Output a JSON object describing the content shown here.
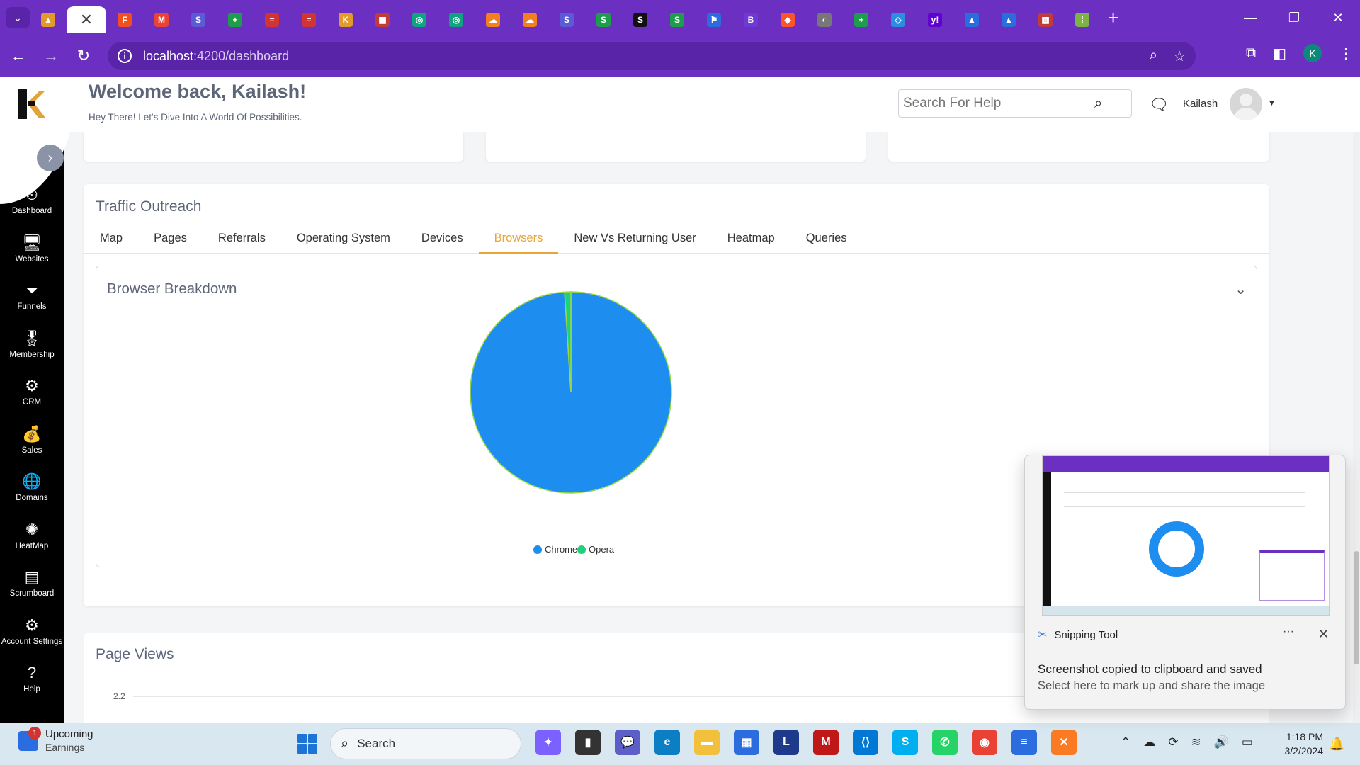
{
  "browser": {
    "tabs": [
      {
        "icon": "rocket-icon",
        "color": "#e39a2b",
        "glyph": "▲"
      },
      {
        "icon": "close-icon",
        "color": "",
        "glyph": "✕",
        "active": true
      },
      {
        "icon": "figma-icon",
        "color": "#f24e1e",
        "glyph": "F"
      },
      {
        "icon": "gmail-icon",
        "color": "#ea4335",
        "glyph": "M"
      },
      {
        "icon": "s-app-icon",
        "color": "#5b5bd6",
        "glyph": "S"
      },
      {
        "icon": "plus-sheet-icon",
        "color": "#1e9e4a",
        "glyph": "+"
      },
      {
        "icon": "red-bar-icon",
        "color": "#d23434",
        "glyph": "="
      },
      {
        "icon": "red-bar-icon",
        "color": "#d23434",
        "glyph": "="
      },
      {
        "icon": "k-app-icon",
        "color": "#e39a2b",
        "glyph": "K"
      },
      {
        "icon": "image-icon",
        "color": "#c23b3b",
        "glyph": "▣"
      },
      {
        "icon": "chatgpt-icon",
        "color": "#10a37f",
        "glyph": "◎"
      },
      {
        "icon": "chatgpt-icon",
        "color": "#10a37f",
        "glyph": "◎"
      },
      {
        "icon": "cloud-icon",
        "color": "#f38020",
        "glyph": "☁"
      },
      {
        "icon": "cloud-icon",
        "color": "#f38020",
        "glyph": "☁"
      },
      {
        "icon": "s-app-icon",
        "color": "#5b5bd6",
        "glyph": "S"
      },
      {
        "icon": "s-green-icon",
        "color": "#1e9e4a",
        "glyph": "S"
      },
      {
        "icon": "s-dark-icon",
        "color": "#111111",
        "glyph": "S"
      },
      {
        "icon": "s-green-icon",
        "color": "#1e9e4a",
        "glyph": "S"
      },
      {
        "icon": "flag-icon",
        "color": "#2b6cde",
        "glyph": "⚑"
      },
      {
        "icon": "b-app-icon",
        "color": "#6d3ad6",
        "glyph": "B"
      },
      {
        "icon": "brave-icon",
        "color": "#fb542b",
        "glyph": "◆"
      },
      {
        "icon": "globe-icon",
        "color": "#777777",
        "glyph": "◐"
      },
      {
        "icon": "plus-sheet-icon",
        "color": "#1e9e4a",
        "glyph": "+"
      },
      {
        "icon": "diamond-icon",
        "color": "#2b8ede",
        "glyph": "◇"
      },
      {
        "icon": "yahoo-icon",
        "color": "#6001d2",
        "glyph": "y!"
      },
      {
        "icon": "triangle-icon",
        "color": "#2b6cde",
        "glyph": "▲"
      },
      {
        "icon": "triangle-icon",
        "color": "#2b6cde",
        "glyph": "▲"
      },
      {
        "icon": "grid-icon",
        "color": "#c23b3b",
        "glyph": "▦"
      },
      {
        "icon": "dots-icon",
        "color": "#7cb342",
        "glyph": "⁞"
      }
    ],
    "url_host": "localhost",
    "url_path": ":4200/dashboard",
    "profile_initial": "K"
  },
  "sidebar": {
    "items": [
      {
        "label": "Dashboard",
        "icon": "dashboard-gauge-icon",
        "glyph": "⏲"
      },
      {
        "label": "Websites",
        "icon": "monitor-icon",
        "glyph": "🖥"
      },
      {
        "label": "Funnels",
        "icon": "funnel-icon",
        "glyph": "⏷"
      },
      {
        "label": "Membership",
        "icon": "badge-icon",
        "glyph": "🎖"
      },
      {
        "label": "CRM",
        "icon": "crm-icon",
        "glyph": "⚙"
      },
      {
        "label": "Sales",
        "icon": "sales-icon",
        "glyph": "💰"
      },
      {
        "label": "Domains",
        "icon": "domains-icon",
        "glyph": "🌐"
      },
      {
        "label": "HeatMap",
        "icon": "heatmap-icon",
        "glyph": "✺"
      },
      {
        "label": "Scrumboard",
        "icon": "scrumboard-icon",
        "glyph": "▤"
      },
      {
        "label": "Account Settings",
        "icon": "gears-icon",
        "glyph": "⚙"
      },
      {
        "label": "Help",
        "icon": "help-icon",
        "glyph": "?"
      }
    ]
  },
  "header": {
    "welcome": "Welcome back, Kailash!",
    "subtitle": "Hey There! Let's Dive Into A World Of Possibilities.",
    "search_placeholder": "Search For Help",
    "username": "Kailash"
  },
  "traffic": {
    "title": "Traffic Outreach",
    "tabs": [
      "Map",
      "Pages",
      "Referrals",
      "Operating System",
      "Devices",
      "Browsers",
      "New Vs Returning User",
      "Heatmap",
      "Queries"
    ],
    "active_tab": "Browsers"
  },
  "breakdown": {
    "title": "Browser Breakdown"
  },
  "chart_data": {
    "type": "pie",
    "categories": [
      "Chrome",
      "Opera"
    ],
    "values": [
      99,
      1
    ],
    "colors": [
      "#1d8ef0",
      "#1fd17c"
    ],
    "legend": "bottom"
  },
  "page_views": {
    "title": "Page Views",
    "y_tick": "2.2"
  },
  "toast": {
    "app": "Snipping Tool",
    "message": "Screenshot copied to clipboard and saved",
    "submessage": "Select here to mark up and share the image"
  },
  "taskbar": {
    "weather_title": "Upcoming",
    "weather_sub": "Earnings",
    "weather_badge": "1",
    "search_label": "Search",
    "apps": [
      {
        "icon": "copilot-icon",
        "color": "#7b61ff",
        "glyph": "✦"
      },
      {
        "icon": "terminal-icon",
        "color": "#333333",
        "glyph": "▮"
      },
      {
        "icon": "teams-chat-icon",
        "color": "#5b5fc7",
        "glyph": "💬"
      },
      {
        "icon": "edge-icon",
        "color": "#0c7fc4",
        "glyph": "e"
      },
      {
        "icon": "file-explorer-icon",
        "color": "#f3c03b",
        "glyph": "▬"
      },
      {
        "icon": "store-icon",
        "color": "#2b6cde",
        "glyph": "▦"
      },
      {
        "icon": "l-app-icon",
        "color": "#1e3a8a",
        "glyph": "L"
      },
      {
        "icon": "mcafee-icon",
        "color": "#c01818",
        "glyph": "M"
      },
      {
        "icon": "vscode-icon",
        "color": "#0078d4",
        "glyph": "⟨⟩"
      },
      {
        "icon": "skype-icon",
        "color": "#00aff0",
        "glyph": "S"
      },
      {
        "icon": "whatsapp-icon",
        "color": "#25d366",
        "glyph": "✆"
      },
      {
        "icon": "chrome-icon",
        "color": "#e94235",
        "glyph": "◉"
      },
      {
        "icon": "notepad-icon",
        "color": "#2b6cde",
        "glyph": "≡"
      },
      {
        "icon": "xampp-icon",
        "color": "#fb7a24",
        "glyph": "✕"
      }
    ],
    "time": "1:18 PM",
    "date": "3/2/2024"
  }
}
